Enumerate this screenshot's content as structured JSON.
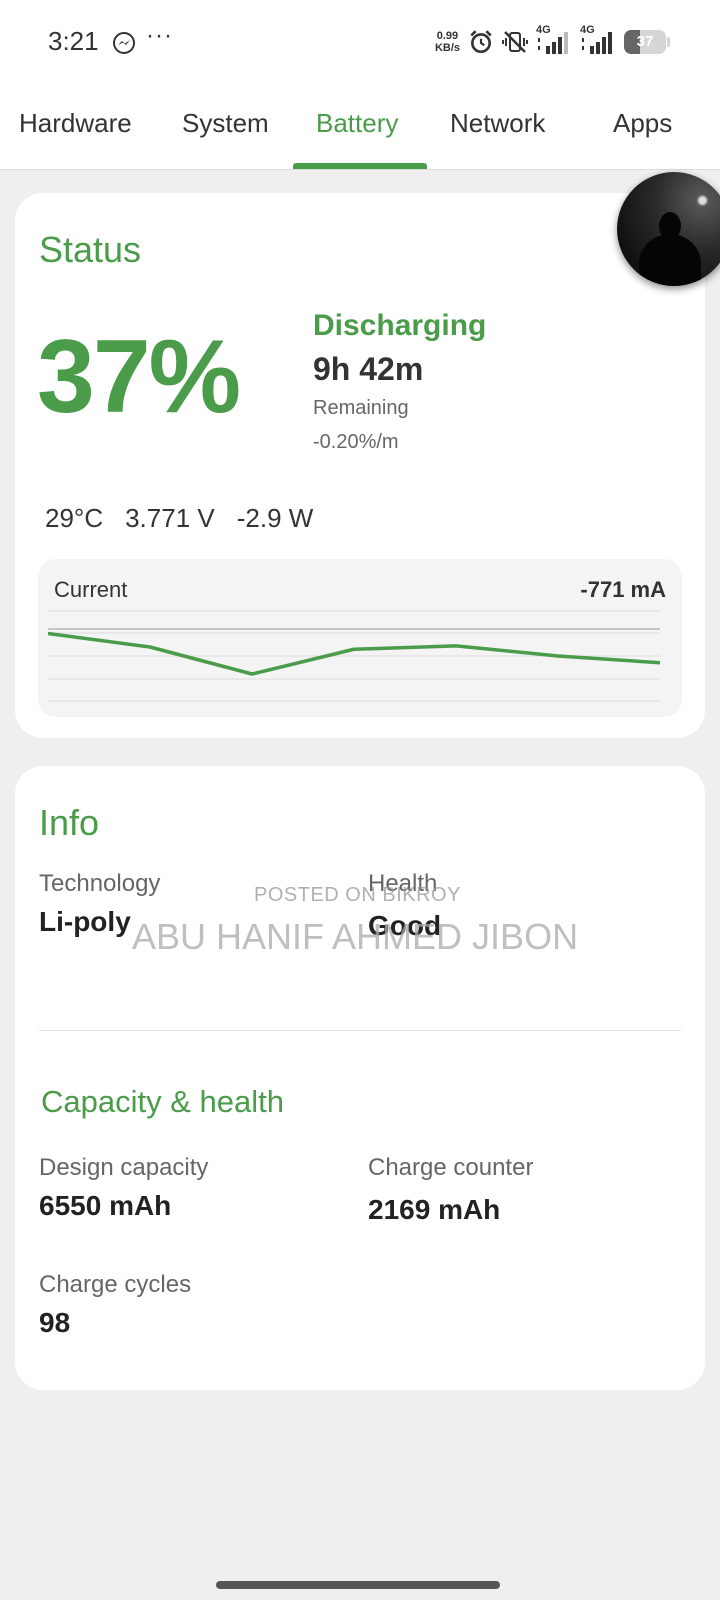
{
  "status_bar": {
    "time": "3:21",
    "more": "···",
    "speed_value": "0.99",
    "speed_unit": "KB/s",
    "network_1": "4G",
    "network_2": "4G",
    "battery_level": "37",
    "battery_fraction": 0.37
  },
  "tabs": [
    {
      "label": "Hardware",
      "active": false
    },
    {
      "label": "System",
      "active": false
    },
    {
      "label": "Battery",
      "active": true
    },
    {
      "label": "Network",
      "active": false
    },
    {
      "label": "Apps",
      "active": false
    }
  ],
  "status": {
    "title": "Status",
    "percent": "37%",
    "state": "Discharging",
    "time_remaining": "9h 42m",
    "remaining_label": "Remaining",
    "rate": "-0.20%/m",
    "temperature": "29°C",
    "voltage": "3.771 V",
    "power": "-2.9 W",
    "current_label": "Current",
    "current_value": "-771 mA"
  },
  "chart_data": {
    "type": "line",
    "series": [
      {
        "values": [
          -700,
          -760,
          -880,
          -770,
          -755,
          -800,
          -830
        ]
      }
    ],
    "reference_line": -680,
    "ylim": [
      -1000,
      -600
    ],
    "grid": true
  },
  "info": {
    "title": "Info",
    "technology_label": "Technology",
    "technology_value": "Li-poly",
    "health_label": "Health",
    "health_value": "Good"
  },
  "capacity": {
    "title": "Capacity & health",
    "design_capacity_label": "Design capacity",
    "design_capacity_value": "6550 mAh",
    "charge_counter_label": "Charge counter",
    "charge_counter_value": "2169 mAh",
    "charge_cycles_label": "Charge cycles",
    "charge_cycles_value": "98"
  },
  "watermark": {
    "line1": "POSTED ON BIKROY",
    "line2": "ABU HANIF AHMED JIBON"
  },
  "colors": {
    "accent": "#4a9b4a",
    "background": "#efefef",
    "card": "#ffffff"
  }
}
